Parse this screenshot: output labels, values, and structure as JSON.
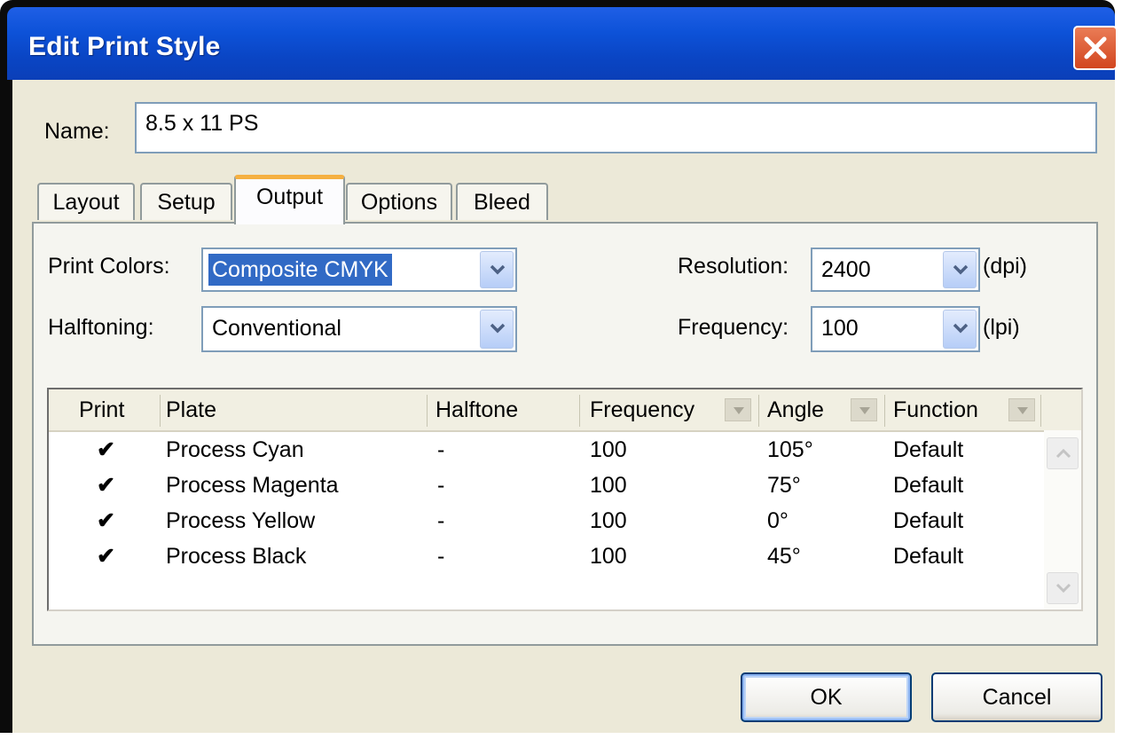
{
  "window": {
    "title": "Edit Print Style",
    "close_icon": "close-icon"
  },
  "name_field": {
    "label": "Name:",
    "value": "8.5 x 11 PS"
  },
  "tabs": [
    {
      "label": "Layout",
      "active": false
    },
    {
      "label": "Setup",
      "active": false
    },
    {
      "label": "Output",
      "active": true
    },
    {
      "label": "Options",
      "active": false
    },
    {
      "label": "Bleed",
      "active": false
    }
  ],
  "output": {
    "print_colors": {
      "label": "Print Colors:",
      "value": "Composite CMYK"
    },
    "halftoning": {
      "label": "Halftoning:",
      "value": "Conventional"
    },
    "resolution": {
      "label": "Resolution:",
      "value": "2400",
      "unit": "(dpi)"
    },
    "frequency": {
      "label": "Frequency:",
      "value": "100",
      "unit": "(lpi)"
    }
  },
  "plates_table": {
    "columns": [
      "Print",
      "Plate",
      "Halftone",
      "Frequency",
      "Angle",
      "Function"
    ],
    "rows": [
      {
        "print": "✔",
        "plate": "Process Cyan",
        "halftone": "-",
        "frequency": "100",
        "angle": "105°",
        "function": "Default"
      },
      {
        "print": "✔",
        "plate": "Process Magenta",
        "halftone": "-",
        "frequency": "100",
        "angle": "75°",
        "function": "Default"
      },
      {
        "print": "✔",
        "plate": "Process Yellow",
        "halftone": "-",
        "frequency": "100",
        "angle": "0°",
        "function": "Default"
      },
      {
        "print": "✔",
        "plate": "Process Black",
        "halftone": "-",
        "frequency": "100",
        "angle": "45°",
        "function": "Default"
      }
    ]
  },
  "buttons": {
    "ok": "OK",
    "cancel": "Cancel"
  },
  "colors": {
    "titlebar": "#0d52d8",
    "dialog_bg": "#ece9d8",
    "selection": "#316ac5",
    "active_tab_accent": "#f5b041",
    "close_button": "#d2461f"
  }
}
